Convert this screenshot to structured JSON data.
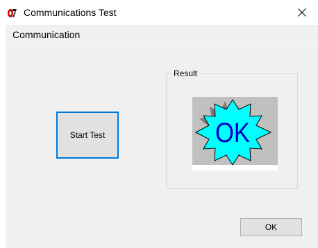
{
  "window": {
    "title": "Communications Test",
    "close_icon": "close-icon",
    "app_icon": "app-logo-icon"
  },
  "menu": {
    "items": [
      {
        "label": "Communication"
      }
    ]
  },
  "start_test": {
    "label": "Start Test"
  },
  "result": {
    "group_label": "Result",
    "status_image_text": "OK",
    "colors": {
      "badge_fill": "#00ffff",
      "badge_text": "#0000cc",
      "shadow": "#7a7a7a",
      "background": "#c0c0c0"
    }
  },
  "footer": {
    "ok_label": "OK"
  },
  "colors": {
    "client_bg": "#f0f0f0",
    "focus_border": "#0078d7",
    "button_face": "#e1e1e1"
  }
}
